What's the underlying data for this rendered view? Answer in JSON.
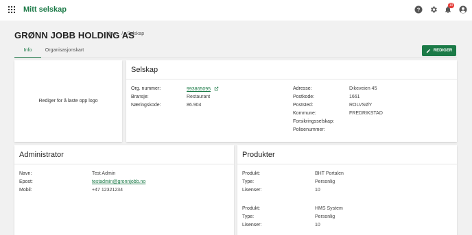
{
  "app": {
    "title": "Mitt selskap",
    "notification_count": "10"
  },
  "page": {
    "title": "GRØNN JOBB HOLDING AS",
    "breadcrumb": [
      "Hjem",
      "Selskap"
    ]
  },
  "tabs": [
    "Info",
    "Organisasjonskart"
  ],
  "edit_button": "REDIGER",
  "logo": {
    "text": "Rediger for å laste opp logo"
  },
  "selskap": {
    "title": "Selskap",
    "left": {
      "org_label": "Org. nummer:",
      "org_value": "993865095",
      "bransje_label": "Bransje:",
      "bransje_value": "Restaurant",
      "naering_label": "Næringskode:",
      "naering_value": "86.904"
    },
    "right": {
      "adresse_label": "Adresse:",
      "adresse_value": "Dikeveien 45",
      "postkode_label": "Postkode:",
      "postkode_value": "1661",
      "poststed_label": "Poststed:",
      "poststed_value": "ROLVSØY",
      "kommune_label": "Kommune:",
      "kommune_value": "FREDRIKSTAD",
      "forsikring_label": "Forsikringsselskap:",
      "polise_label": "Polisenummer:"
    }
  },
  "administrator": {
    "title": "Administrator",
    "navn_label": "Navn:",
    "navn_value": "Test Admin",
    "epost_label": "Epost:",
    "epost_value": "testadmin@gronnjobb.no",
    "mobil_label": "Mobil:",
    "mobil_value": "+47 12321234"
  },
  "produkter": {
    "title": "Produkter",
    "items": [
      {
        "produkt_label": "Produkt:",
        "produkt_value": "BHT Portalen",
        "type_label": "Type:",
        "type_value": "Personlig",
        "lisenser_label": "Lisenser:",
        "lisenser_value": "10"
      },
      {
        "produkt_label": "Produkt:",
        "produkt_value": "HMS System",
        "type_label": "Type:",
        "type_value": "Personlig",
        "lisenser_label": "Lisenser:",
        "lisenser_value": "10"
      }
    ]
  },
  "colors": {
    "brand": "#1b7a47",
    "badge": "#e53935"
  },
  "icons": [
    "apps-grid-icon",
    "help-icon",
    "gear-icon",
    "bell-icon",
    "account-icon",
    "pencil-icon",
    "external-link-icon"
  ]
}
